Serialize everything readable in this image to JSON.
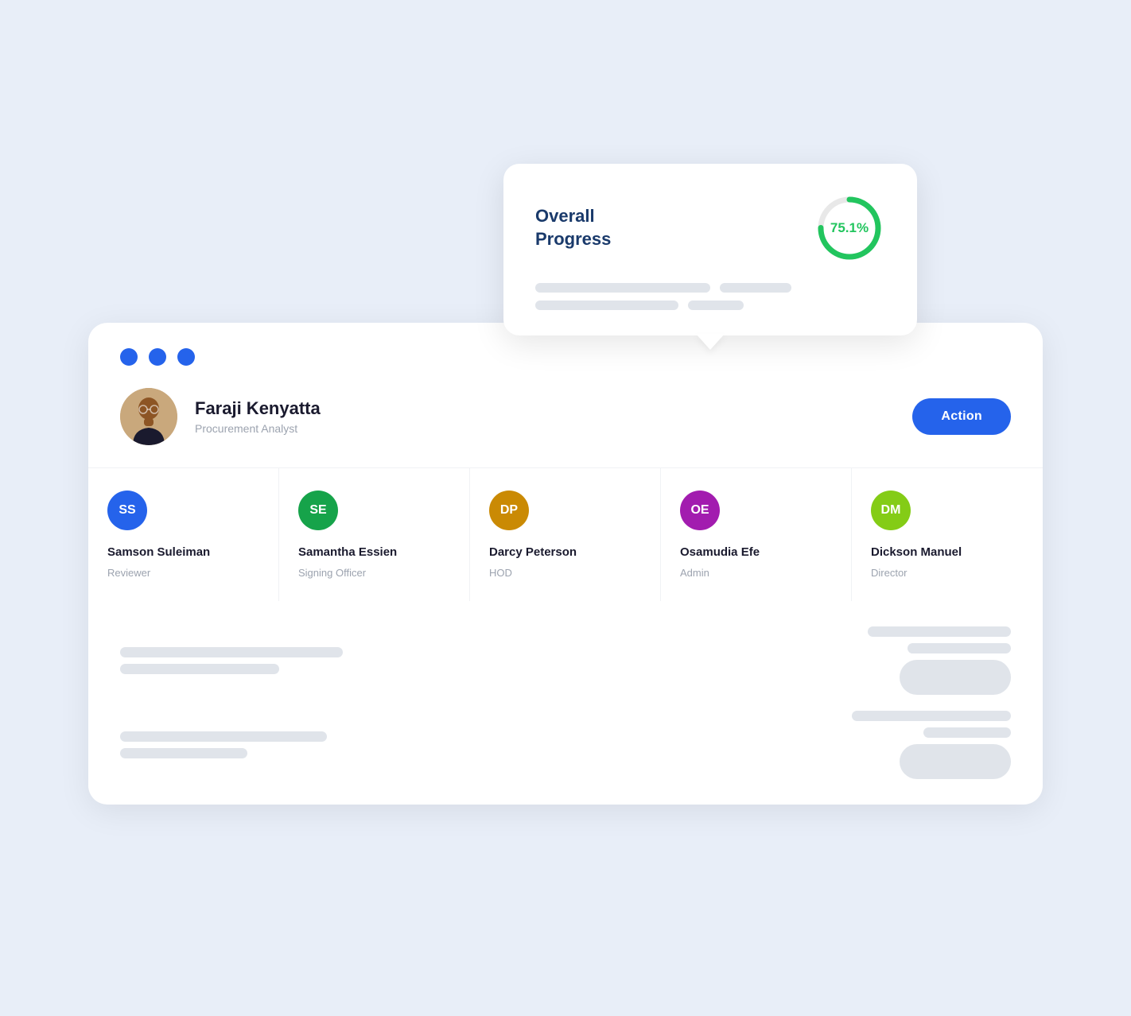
{
  "progress_card": {
    "title_line1": "Overall",
    "title_line2": "Progress",
    "percentage": "75.1%",
    "circle_color": "#22c55e"
  },
  "dots": [
    "dot1",
    "dot2",
    "dot3"
  ],
  "profile": {
    "name": "Faraji Kenyatta",
    "job_title": "Procurement Analyst",
    "action_label": "Action"
  },
  "team": [
    {
      "initials": "SS",
      "bg_color": "#2563eb",
      "name": "Samson Suleiman",
      "role": "Reviewer"
    },
    {
      "initials": "SE",
      "bg_color": "#16a34a",
      "name": "Samantha Essien",
      "role": "Signing Officer"
    },
    {
      "initials": "DP",
      "bg_color": "#ca8a04",
      "name": "Darcy Peterson",
      "role": "HOD"
    },
    {
      "initials": "OE",
      "bg_color": "#a21caf",
      "name": "Osamudia Efe",
      "role": "Admin"
    },
    {
      "initials": "DM",
      "bg_color": "#84cc16",
      "name": "Dickson Manuel",
      "role": "Director"
    }
  ],
  "skeleton": {
    "rows": [
      {
        "bars": [
          220,
          90
        ]
      },
      {
        "bars": [
          180,
          70
        ]
      }
    ]
  },
  "bottom_rows": [
    {
      "left_bars": [
        280,
        200
      ],
      "right_bars": [
        180,
        130
      ],
      "has_button": true
    },
    {
      "left_bars": [
        260,
        160
      ],
      "right_bars": [
        200,
        110
      ],
      "has_button": true
    }
  ]
}
